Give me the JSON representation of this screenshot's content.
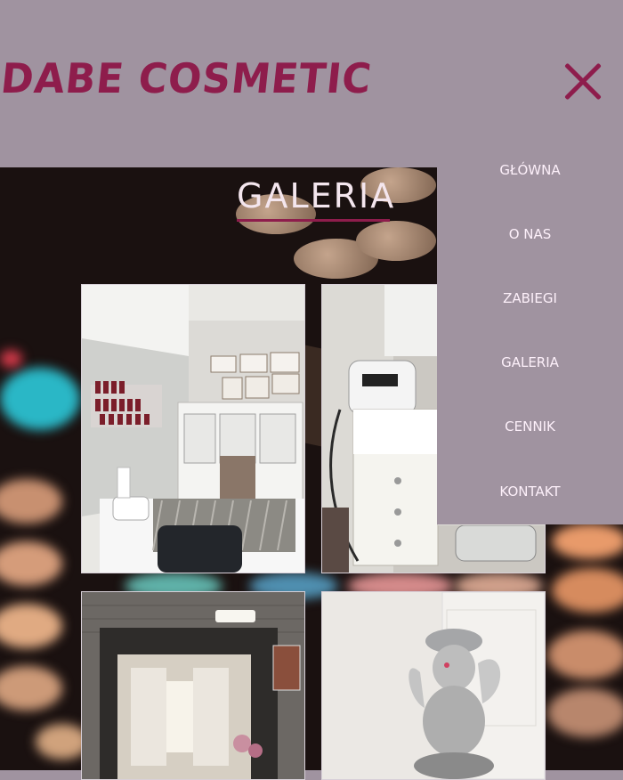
{
  "header": {
    "logo": "DABE COSMETIC"
  },
  "page": {
    "title": "GALERIA"
  },
  "menu": {
    "items": [
      {
        "label": "GŁÓWNA"
      },
      {
        "label": "O NAS"
      },
      {
        "label": "ZABIEGI"
      },
      {
        "label": "GALERIA"
      },
      {
        "label": "CENNIK"
      },
      {
        "label": "KONTAKT"
      }
    ]
  },
  "colors": {
    "brand": "#8e1d4c",
    "header_bg": "#a093a0",
    "menu_text": "#fdf0fa"
  },
  "icons": {
    "close": "close-icon"
  }
}
